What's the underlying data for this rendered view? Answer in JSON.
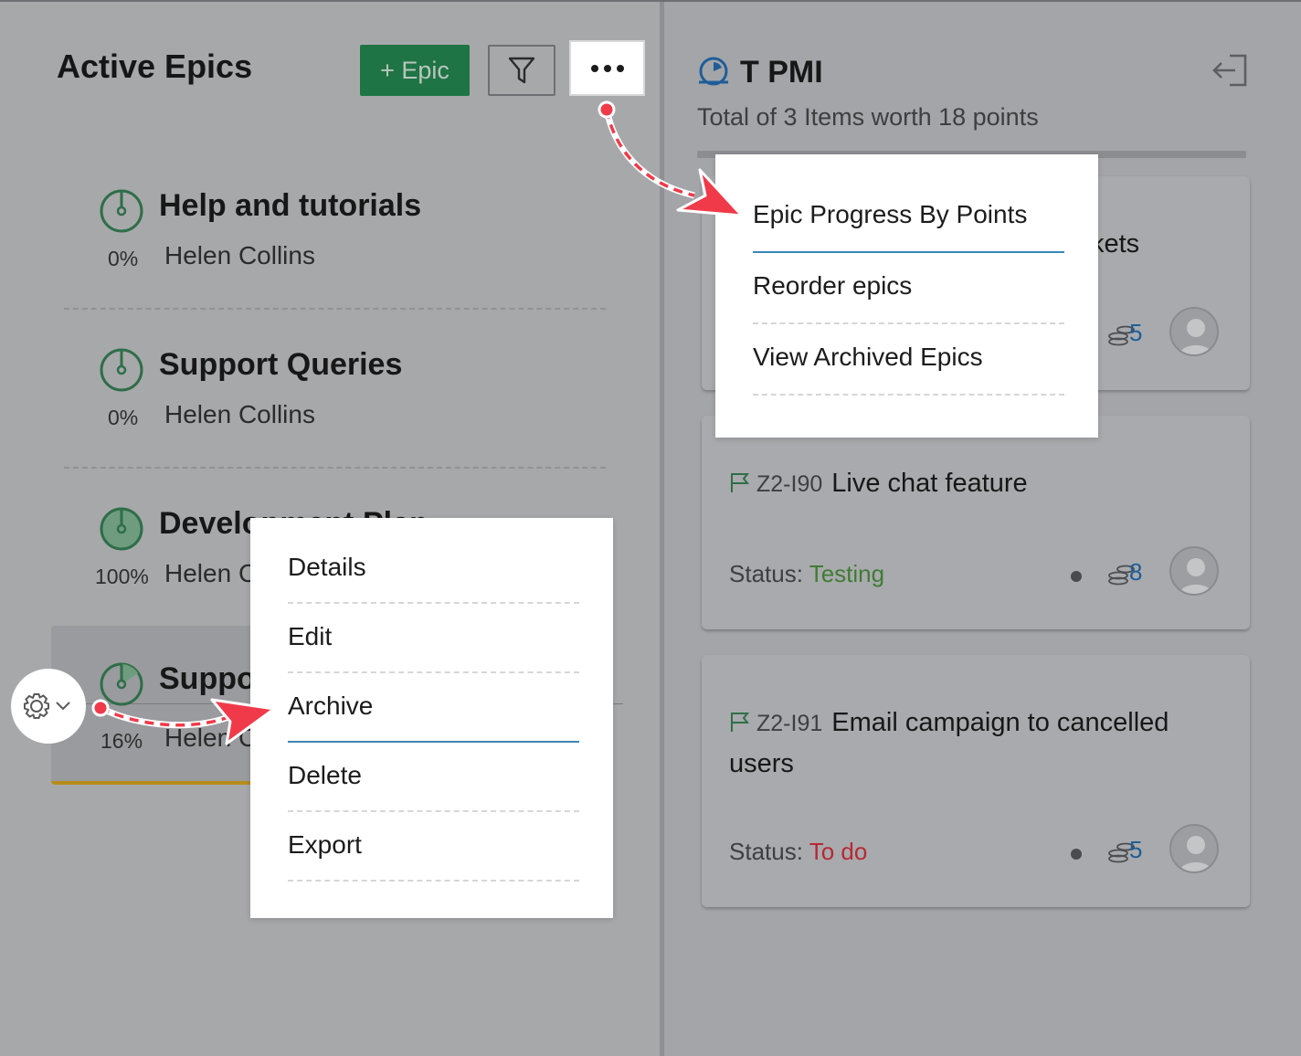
{
  "left": {
    "title": "Active Epics",
    "add_epic_label": "+ Epic",
    "epics": [
      {
        "name": "Help and tutorials",
        "percent": "0%",
        "owner": "Helen Collins"
      },
      {
        "name": "Support Queries",
        "percent": "0%",
        "owner": "Helen Collins"
      },
      {
        "name": "Development Plan",
        "percent": "100%",
        "owner": "Helen Collins"
      },
      {
        "name": "Support",
        "percent": "16%",
        "owner": "Helen Collins"
      }
    ]
  },
  "more_menu": {
    "items": [
      "Epic Progress By Points",
      "Reorder epics",
      "View Archived Epics"
    ],
    "active_item": "Epic Progress By Points"
  },
  "context_menu": {
    "items": [
      "Details",
      "Edit",
      "Archive",
      "Delete",
      "Export"
    ],
    "active_item": "Archive"
  },
  "right": {
    "title": "T PMI",
    "subtitle": "Total of 3 Items worth 18 points",
    "cards": [
      {
        "title_fragment": "kets",
        "points": "5"
      },
      {
        "key": "Z2-I90",
        "title": "Live chat feature",
        "status_label": "Status:",
        "status": "Testing",
        "points": "8"
      },
      {
        "key": "Z2-I91",
        "title": "Email campaign to cancelled users",
        "status_label": "Status:",
        "status": "To do",
        "points": "5"
      }
    ]
  },
  "colors": {
    "primary_button": "#1e7445",
    "status_testing": "#3f7c34",
    "status_todo": "#b62934",
    "points": "#1f5d99",
    "highlight_underline": "#3a87b5",
    "annotation_arrow": "#f03a4a"
  },
  "icons": {
    "filter": "filter-icon",
    "more": "more-dots-icon",
    "settings": "gear-icon",
    "sprint": "sprint-clock-icon",
    "exit": "exit-panel-icon",
    "flag": "flag-icon",
    "points": "coins-icon",
    "user": "user-avatar-icon"
  }
}
